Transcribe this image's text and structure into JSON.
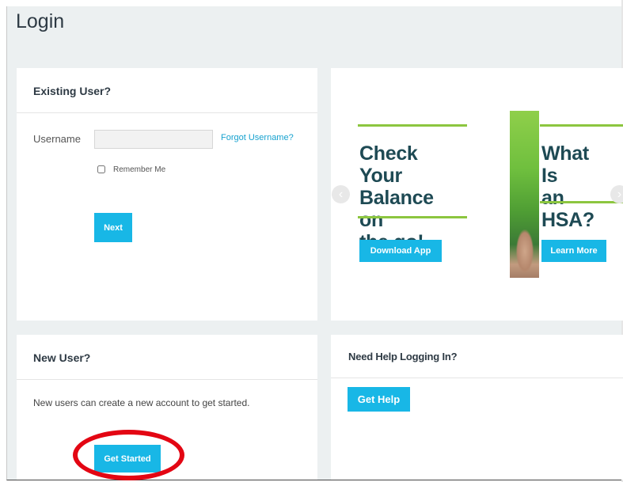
{
  "page": {
    "title": "Login"
  },
  "existing_user": {
    "heading": "Existing User?",
    "username_label": "Username",
    "username_value": "",
    "forgot_link": "Forgot Username?",
    "remember_label": "Remember Me",
    "remember_checked": false,
    "next_button": "Next"
  },
  "carousel": {
    "slides": [
      {
        "title_lines": [
          "Check Your",
          "Balance on",
          "the go!"
        ],
        "button": "Download App"
      },
      {
        "title_lines": [
          "What Is",
          "an HSA?"
        ],
        "button": "Learn More"
      }
    ],
    "prev_icon": "‹",
    "next_icon": "›"
  },
  "new_user": {
    "heading": "New User?",
    "description": "New users can create a new account to get started.",
    "get_started_button": "Get Started"
  },
  "help": {
    "heading": "Need Help Logging In?",
    "get_help_button": "Get Help"
  },
  "colors": {
    "accent": "#18b7e6",
    "brand_green": "#8cc63f",
    "heading_text": "#1e4a54",
    "highlight_circle": "#e30613"
  }
}
